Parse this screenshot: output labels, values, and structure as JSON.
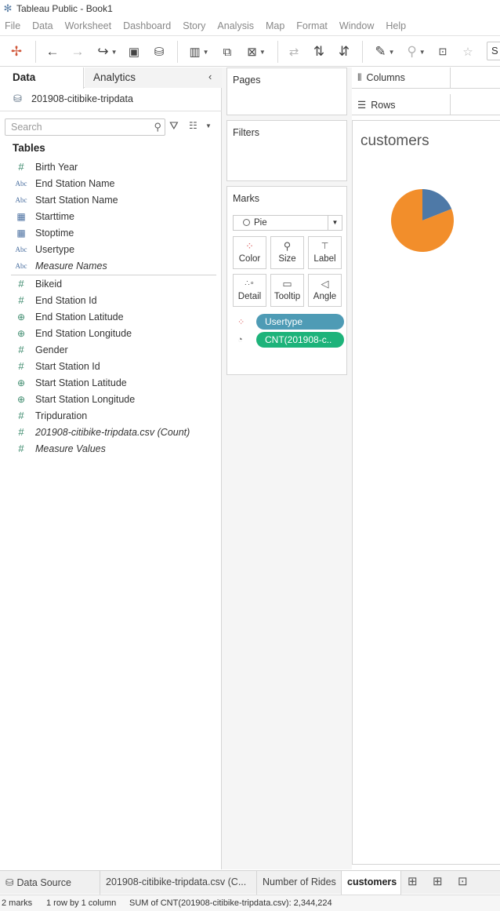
{
  "window": {
    "title": "Tableau Public - Book1"
  },
  "menu": [
    "File",
    "Data",
    "Worksheet",
    "Dashboard",
    "Story",
    "Analysis",
    "Map",
    "Format",
    "Window",
    "Help"
  ],
  "toolbar": {
    "show_me_label": "S"
  },
  "data_pane": {
    "tab_data": "Data",
    "tab_analytics": "Analytics",
    "datasource": "201908-citibike-tripdata",
    "search_placeholder": "Search",
    "tables_header": "Tables",
    "dimensions": [
      {
        "label": "Birth Year",
        "type": "number"
      },
      {
        "label": "End Station Name",
        "type": "string"
      },
      {
        "label": "Start Station Name",
        "type": "string"
      },
      {
        "label": "Starttime",
        "type": "date"
      },
      {
        "label": "Stoptime",
        "type": "date"
      },
      {
        "label": "Usertype",
        "type": "string"
      },
      {
        "label": "Measure Names",
        "type": "string"
      }
    ],
    "measures": [
      {
        "label": "Bikeid",
        "type": "number"
      },
      {
        "label": "End Station Id",
        "type": "number"
      },
      {
        "label": "End Station Latitude",
        "type": "geo"
      },
      {
        "label": "End Station Longitude",
        "type": "geo"
      },
      {
        "label": "Gender",
        "type": "number"
      },
      {
        "label": "Start Station Id",
        "type": "number"
      },
      {
        "label": "Start Station Latitude",
        "type": "geo"
      },
      {
        "label": "Start Station Longitude",
        "type": "geo"
      },
      {
        "label": "Tripduration",
        "type": "number"
      },
      {
        "label": "201908-citibike-tripdata.csv (Count)",
        "type": "number"
      },
      {
        "label": "Measure Values",
        "type": "number"
      }
    ]
  },
  "cards": {
    "pages": "Pages",
    "filters": "Filters",
    "marks": "Marks",
    "mark_type": "Pie",
    "buttons": [
      "Color",
      "Size",
      "Label",
      "Detail",
      "Tooltip",
      "Angle"
    ],
    "pills": [
      {
        "label": "Usertype",
        "color": "#4e9bb5"
      },
      {
        "label": "CNT(201908-c..",
        "color": "#1db37a"
      }
    ]
  },
  "shelves": {
    "columns": "Columns",
    "rows": "Rows"
  },
  "viz": {
    "title": "customers",
    "colors": {
      "customer": "#4e79a7",
      "subscriber": "#f28e2b"
    }
  },
  "chart_data": {
    "type": "pie",
    "title": "customers",
    "slices": [
      {
        "value": 19
      },
      {
        "value": 81
      }
    ]
  },
  "sheet_tabs": [
    "Data Source",
    "201908-citibike-tripdata.csv (C...",
    "Number of Rides",
    "customers"
  ],
  "status": {
    "marks": "2 marks",
    "dims": "1 row by 1 column",
    "sum": "SUM of CNT(201908-citibike-tripdata.csv): 2,344,224"
  }
}
